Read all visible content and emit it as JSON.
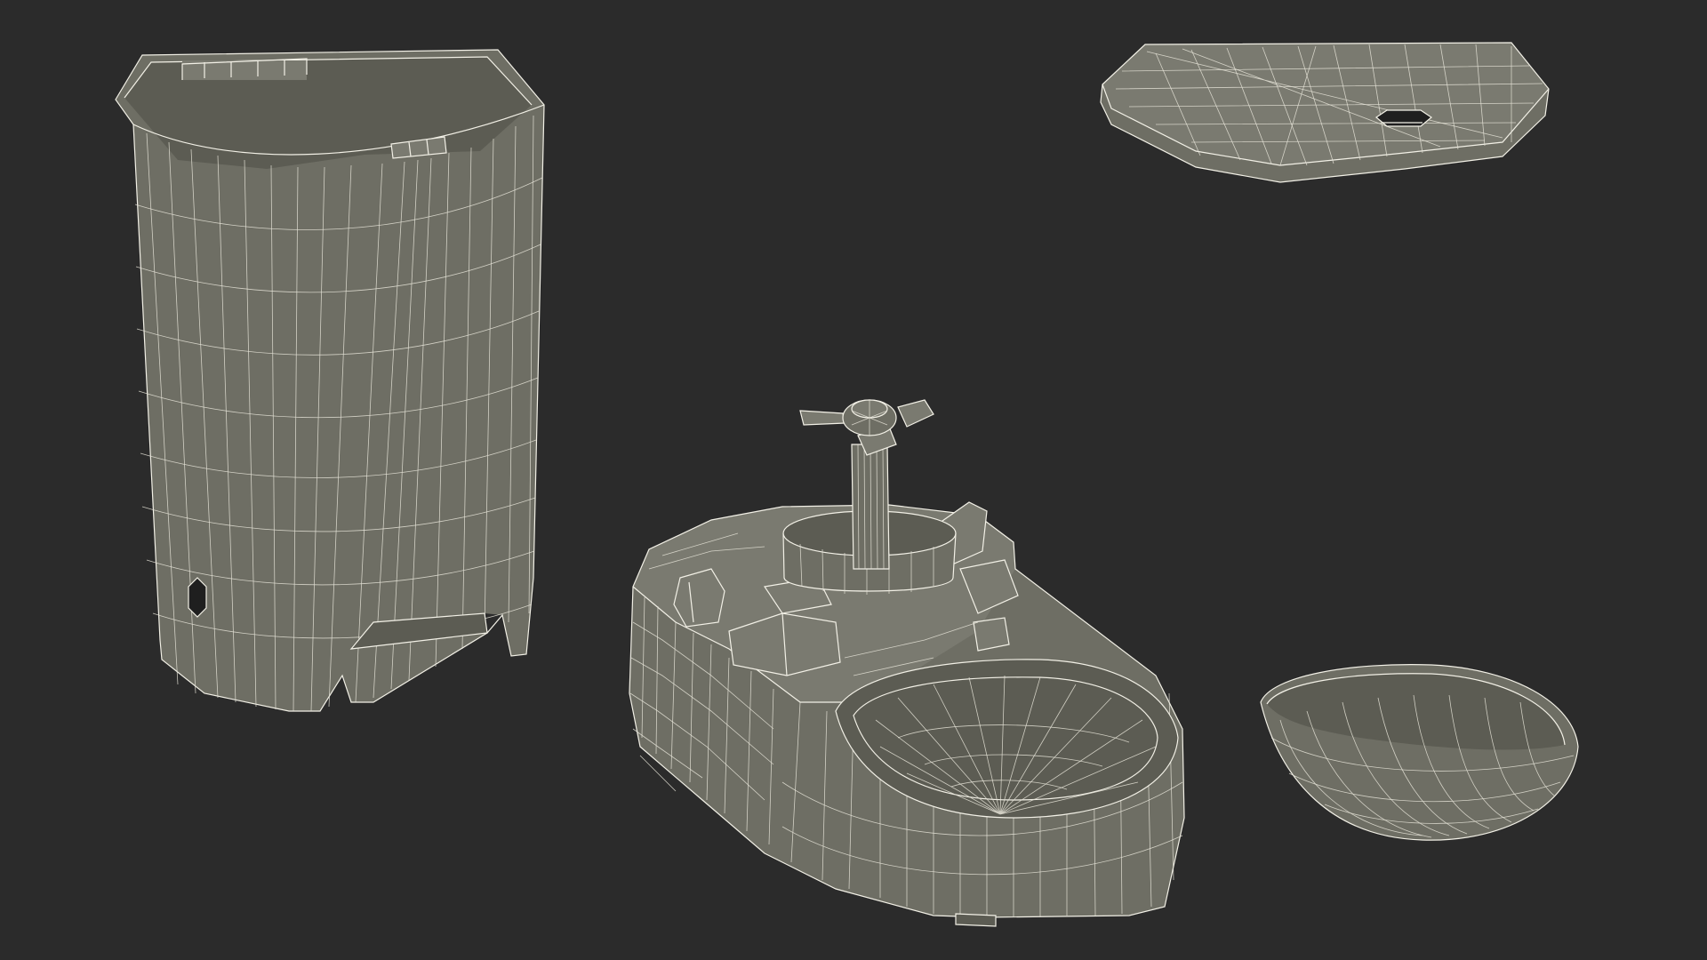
{
  "scene": {
    "background_color": "#2b2b2b",
    "mesh_fill_color": "#6e6e64",
    "wire_color": "#e4e2d6",
    "objects": [
      {
        "name": "hopper-container"
      },
      {
        "name": "hopper-lid"
      },
      {
        "name": "feeder-base"
      },
      {
        "name": "food-bowl"
      }
    ]
  }
}
